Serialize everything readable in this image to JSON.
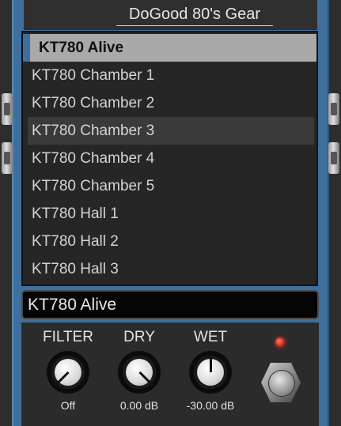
{
  "header": {
    "title": "DoGood 80's Gear"
  },
  "presets": {
    "items": [
      {
        "label": "KT780 Alive"
      },
      {
        "label": "KT780 Chamber 1"
      },
      {
        "label": "KT780 Chamber 2"
      },
      {
        "label": "KT780 Chamber 3"
      },
      {
        "label": "KT780 Chamber 4"
      },
      {
        "label": "KT780 Chamber 5"
      },
      {
        "label": "KT780 Hall 1"
      },
      {
        "label": "KT780 Hall 2"
      },
      {
        "label": "KT780 Hall 3"
      }
    ],
    "selected_index": 0,
    "hovered_index": 3
  },
  "preset_name": {
    "value": "KT780 Alive"
  },
  "controls": {
    "filter": {
      "label": "FILTER",
      "value": "Off"
    },
    "dry": {
      "label": "DRY",
      "value": "0.00 dB"
    },
    "wet": {
      "label": "WET",
      "value": "-30.00 dB"
    }
  },
  "colors": {
    "accent": "#3e6f9d",
    "selected_row": "#a9a9a9",
    "led": "#d23224"
  }
}
